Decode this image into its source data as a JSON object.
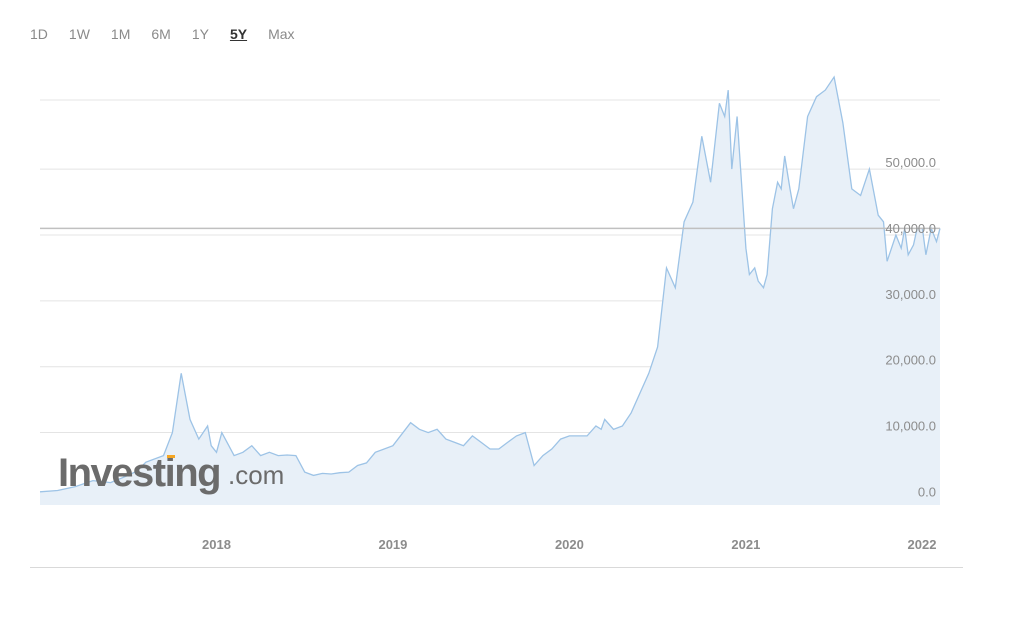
{
  "range_buttons": [
    {
      "label": "1D",
      "active": false
    },
    {
      "label": "1W",
      "active": false
    },
    {
      "label": "1M",
      "active": false
    },
    {
      "label": "6M",
      "active": false
    },
    {
      "label": "1Y",
      "active": false
    },
    {
      "label": "5Y",
      "active": true
    },
    {
      "label": "Max",
      "active": false
    }
  ],
  "watermark": {
    "brand": "Investing",
    "suffix": ".com"
  },
  "colors": {
    "line": "#9dc3e6",
    "fill": "#e8f0f8",
    "grid": "#e4e4e4",
    "current_line": "#c0c0c0",
    "watermark_accent": "#f5a623"
  },
  "chart_data": {
    "type": "area",
    "title": "",
    "xlabel": "",
    "ylabel": "",
    "xlim": [
      2017.0,
      2022.1
    ],
    "ylim": [
      -1000,
      60500
    ],
    "y_ticks": [
      0,
      10000,
      20000,
      30000,
      40000,
      50000
    ],
    "y_tick_labels": [
      "0.0",
      "10,000.0",
      "20,000.0",
      "30,000.0",
      "40,000.0",
      "50,000.0"
    ],
    "x_ticks": [
      2018,
      2019,
      2020,
      2021,
      2022
    ],
    "x_tick_labels": [
      "2018",
      "2019",
      "2020",
      "2021",
      "2022"
    ],
    "grid": true,
    "current_value": 41000,
    "series": [
      {
        "x": [
          2017.0,
          2017.1,
          2017.2,
          2017.3,
          2017.4,
          2017.5,
          2017.55,
          2017.6,
          2017.7,
          2017.75,
          2017.8,
          2017.85,
          2017.9,
          2017.95,
          2017.97,
          2018.0,
          2018.03,
          2018.06,
          2018.1,
          2018.15,
          2018.2,
          2018.25,
          2018.3,
          2018.35,
          2018.4,
          2018.45,
          2018.5,
          2018.55,
          2018.6,
          2018.65,
          2018.7,
          2018.75,
          2018.8,
          2018.85,
          2018.9,
          2019.0,
          2019.1,
          2019.15,
          2019.2,
          2019.25,
          2019.3,
          2019.35,
          2019.4,
          2019.45,
          2019.5,
          2019.55,
          2019.6,
          2019.65,
          2019.7,
          2019.75,
          2019.8,
          2019.85,
          2019.9,
          2019.95,
          2020.0,
          2020.05,
          2020.1,
          2020.15,
          2020.18,
          2020.2,
          2020.25,
          2020.3,
          2020.35,
          2020.4,
          2020.45,
          2020.5,
          2020.55,
          2020.6,
          2020.65,
          2020.7,
          2020.75,
          2020.8,
          2020.85,
          2020.88,
          2020.9,
          2020.92,
          2020.95,
          2020.97,
          2021.0,
          2021.02,
          2021.05,
          2021.07,
          2021.1,
          2021.12,
          2021.15,
          2021.18,
          2021.2,
          2021.22,
          2021.25,
          2021.27,
          2021.3,
          2021.35,
          2021.4,
          2021.45,
          2021.5,
          2021.55,
          2021.6,
          2021.65,
          2021.7,
          2021.75,
          2021.78,
          2021.8,
          2021.85,
          2021.88,
          2021.9,
          2021.92,
          2021.95,
          2021.97,
          2022.0,
          2022.02,
          2022.05,
          2022.08,
          2022.1
        ],
        "y": [
          1000,
          1200,
          1800,
          2700,
          2400,
          3500,
          4200,
          5500,
          6500,
          10000,
          19000,
          12000,
          9000,
          11000,
          8000,
          7000,
          10000,
          8500,
          6500,
          7000,
          8000,
          6500,
          7000,
          6500,
          6600,
          6500,
          4000,
          3500,
          3800,
          3700,
          3900,
          4000,
          5000,
          5400,
          7000,
          8000,
          11500,
          10500,
          10000,
          10500,
          9000,
          8500,
          8000,
          9500,
          8500,
          7500,
          7500,
          8500,
          9500,
          10000,
          5000,
          6500,
          7500,
          9000,
          9500,
          9500,
          9500,
          11000,
          10500,
          12000,
          10500,
          11000,
          13000,
          16000,
          19000,
          23000,
          35000,
          32000,
          42000,
          45000,
          55000,
          48000,
          60000,
          58000,
          62000,
          50000,
          58000,
          50000,
          38000,
          34000,
          35000,
          33000,
          32000,
          34000,
          44000,
          48000,
          47000,
          52000,
          47000,
          44000,
          47000,
          58000,
          61000,
          62000,
          64000,
          57000,
          47000,
          46000,
          50000,
          43000,
          42000,
          36000,
          40000,
          38000,
          41000,
          37000,
          38500,
          41000,
          41000,
          37000,
          41000,
          39000,
          41000
        ]
      }
    ]
  }
}
